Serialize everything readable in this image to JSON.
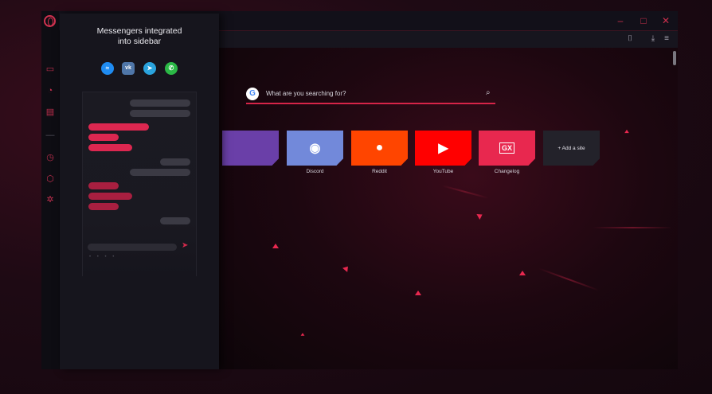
{
  "panel": {
    "title": "Messengers integrated\ninto sidebar",
    "messengers": [
      {
        "name": "messenger",
        "glyph": "≈",
        "color": "#1f8cf2"
      },
      {
        "name": "vk",
        "glyph": "vk",
        "color": "#4f76a8"
      },
      {
        "name": "telegram",
        "glyph": "➤",
        "color": "#2aa3dd"
      },
      {
        "name": "whatsapp",
        "glyph": "✆",
        "color": "#2bb846"
      }
    ],
    "send_glyph": "➤",
    "dots": "• • • •"
  },
  "search": {
    "placeholder": "What are you searching for?",
    "engine_glyph": "G",
    "icon_glyph": "⌕"
  },
  "speed_dial": [
    {
      "label": "",
      "color": "#6a3fa8",
      "glyph": ""
    },
    {
      "label": "Discord",
      "color": "#7289da",
      "glyph": "◉"
    },
    {
      "label": "Reddit",
      "color": "#ff4500",
      "glyph": "●"
    },
    {
      "label": "YouTube",
      "color": "#ff0000",
      "glyph": "▶"
    },
    {
      "label": "Changelog",
      "color": "#e8284f",
      "glyph": "GX"
    },
    {
      "label": "",
      "color": "#23222a",
      "glyph": "+ Add a site"
    }
  ],
  "window": {
    "minimize": "–",
    "maximize": "□",
    "close": "✕",
    "accent": "#d23250"
  },
  "toolbar": {
    "camera_glyph": "⌷",
    "download_glyph": "⤓",
    "settings_glyph": "≡"
  },
  "sidebar": {
    "icons": [
      {
        "name": "twitch-icon",
        "glyph": "▭"
      },
      {
        "name": "speed-icon",
        "glyph": "◔"
      },
      {
        "name": "chat-icon",
        "glyph": "▤"
      },
      {
        "name": "separator",
        "glyph": "—"
      },
      {
        "name": "history-icon",
        "glyph": "◷"
      },
      {
        "name": "cube-icon",
        "glyph": "⬡"
      },
      {
        "name": "gear-icon",
        "glyph": "✲"
      }
    ]
  }
}
